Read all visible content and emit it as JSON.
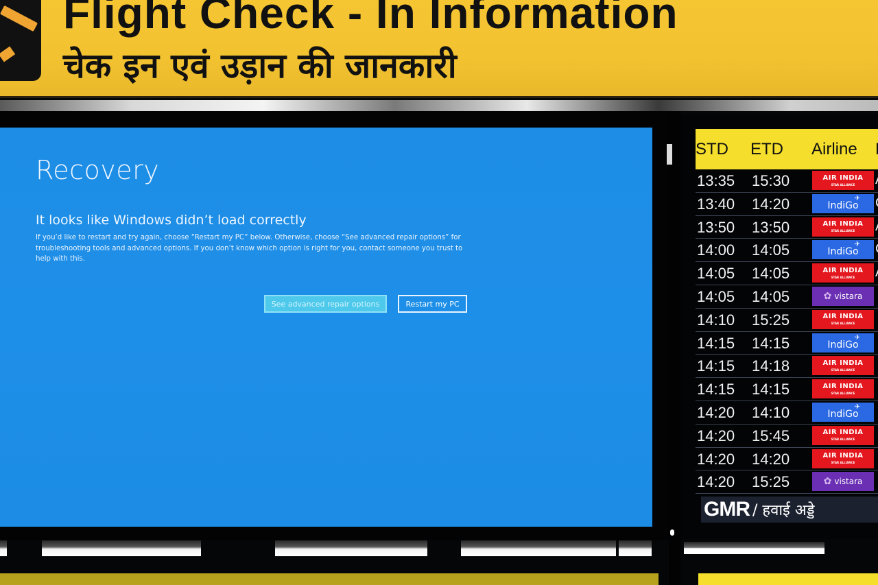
{
  "sign": {
    "title_en": "Flight Check - In Information",
    "title_hi": "चेक इन एवं उड़ान की जानकारी",
    "logo_icon": "airplane-icon"
  },
  "recovery": {
    "title": "Recovery",
    "subtitle": "It looks like Windows didn’t load correctly",
    "body": "If you’d like to restart and try again, choose “Restart my PC” below. Otherwise, choose “See advanced repair options” for troubleshooting tools and advanced options. If you don’t know which option is right for you, contact someone you trust to help with this.",
    "buttons": {
      "advanced": "See advanced repair options",
      "restart": "Restart my PC"
    },
    "colors": {
      "background": "#1e8fe8",
      "advanced_button": "#4ec9ec"
    }
  },
  "flight_board": {
    "headers": {
      "std": "STD",
      "etd": "ETD",
      "airline": "Airline",
      "extra": "F"
    },
    "rows": [
      {
        "std": "13:35",
        "etd": "15:30",
        "airline": "AIR INDIA",
        "type": "airindia",
        "trail": "A"
      },
      {
        "std": "13:40",
        "etd": "14:20",
        "airline": "IndiGo",
        "type": "indigo",
        "trail": "C"
      },
      {
        "std": "13:50",
        "etd": "13:50",
        "airline": "AIR INDIA",
        "type": "airindia",
        "trail": "A"
      },
      {
        "std": "14:00",
        "etd": "14:05",
        "airline": "IndiGo",
        "type": "indigo",
        "trail": "C"
      },
      {
        "std": "14:05",
        "etd": "14:05",
        "airline": "AIR INDIA",
        "type": "airindia",
        "trail": "A"
      },
      {
        "std": "14:05",
        "etd": "14:05",
        "airline": "vistara",
        "type": "vistara",
        "trail": ""
      },
      {
        "std": "14:10",
        "etd": "15:25",
        "airline": "AIR INDIA",
        "type": "airindia",
        "trail": ""
      },
      {
        "std": "14:15",
        "etd": "14:15",
        "airline": "IndiGo",
        "type": "indigo",
        "trail": ""
      },
      {
        "std": "14:15",
        "etd": "14:18",
        "airline": "AIR INDIA",
        "type": "airindia",
        "trail": ""
      },
      {
        "std": "14:15",
        "etd": "14:15",
        "airline": "AIR INDIA",
        "type": "airindia",
        "trail": ""
      },
      {
        "std": "14:20",
        "etd": "14:10",
        "airline": "IndiGo",
        "type": "indigo",
        "trail": ""
      },
      {
        "std": "14:20",
        "etd": "15:45",
        "airline": "AIR INDIA",
        "type": "airindia",
        "trail": ""
      },
      {
        "std": "14:20",
        "etd": "14:20",
        "airline": "AIR INDIA",
        "type": "airindia",
        "trail": ""
      },
      {
        "std": "14:20",
        "etd": "15:25",
        "airline": "vistara",
        "type": "vistara",
        "trail": ""
      }
    ],
    "star_alliance_text": "STAR ALLIANCE",
    "footer": {
      "brand": "GMR",
      "hindi": "/ हवाई अड्डे"
    },
    "colors": {
      "header": "#f5df2c",
      "airindia": "#e3171d",
      "indigo": "#2b69e4",
      "vistara": "#6a2fb3"
    }
  }
}
